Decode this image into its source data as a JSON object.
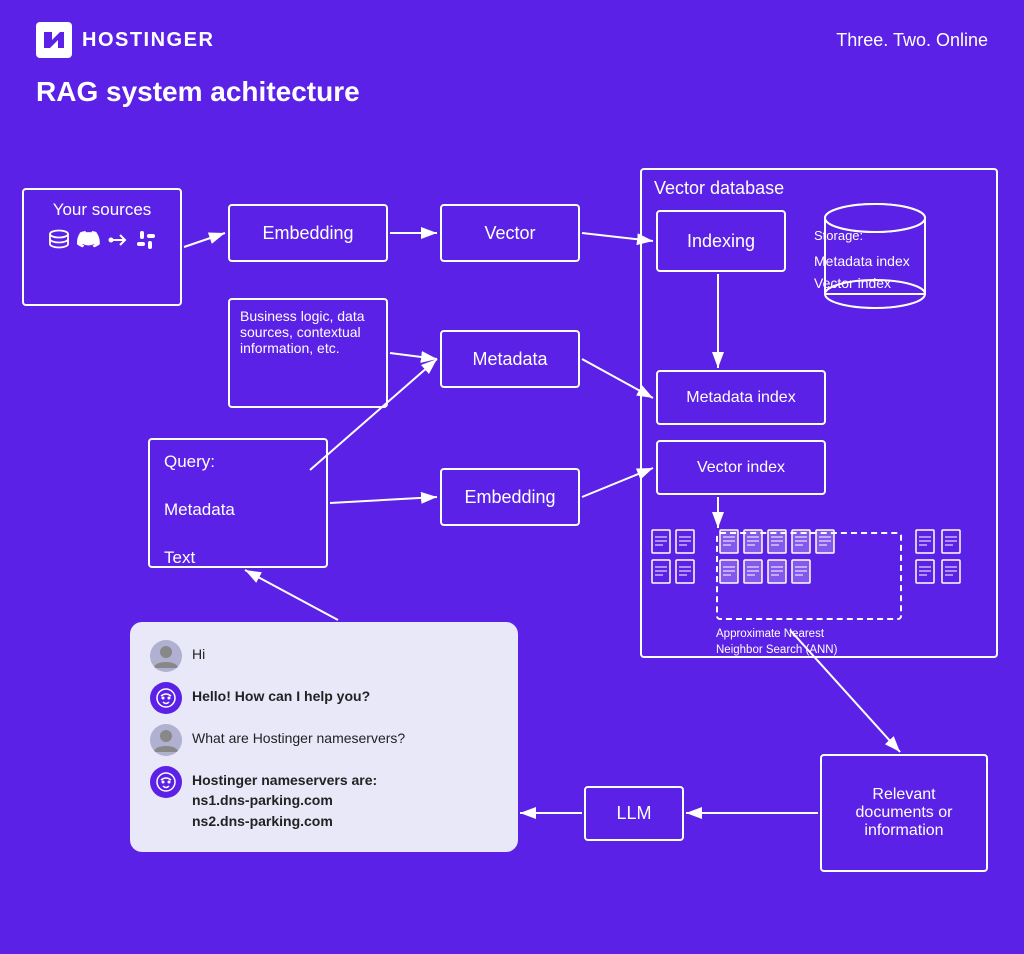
{
  "header": {
    "logo_text": "HOSTINGER",
    "tagline": "Three. Two. Online",
    "page_title": "RAG system achitecture"
  },
  "diagram": {
    "vector_db": {
      "label": "Vector database"
    },
    "sources": {
      "label": "Your sources"
    },
    "embedding_top": {
      "label": "Embedding"
    },
    "vector": {
      "label": "Vector"
    },
    "business": {
      "label": "Business logic, data sources, contextual information, etc."
    },
    "metadata_top": {
      "label": "Metadata"
    },
    "query": {
      "label": "Query:",
      "line2": "Metadata",
      "line3": "Text"
    },
    "embedding_bottom": {
      "label": "Embedding"
    },
    "indexing": {
      "label": "Indexing"
    },
    "storage": {
      "label": "Storage:",
      "item1": "Metadata index",
      "item2": "Vector index"
    },
    "metadata_index": {
      "label": "Metadata index"
    },
    "vector_index": {
      "label": "Vector index"
    },
    "ann_label": "Approximate Nearest\nNeighbor Search (ANN)",
    "llm": {
      "label": "LLM"
    },
    "relevant": {
      "label": "Relevant documents or information"
    }
  },
  "chat": {
    "msg1": "Hi",
    "msg2": "Hello! How can I help you?",
    "msg3": "What are Hostinger nameservers?",
    "msg4": "Hostinger nameservers are:\nns1.dns-parking.com\nns2.dns-parking.com"
  }
}
